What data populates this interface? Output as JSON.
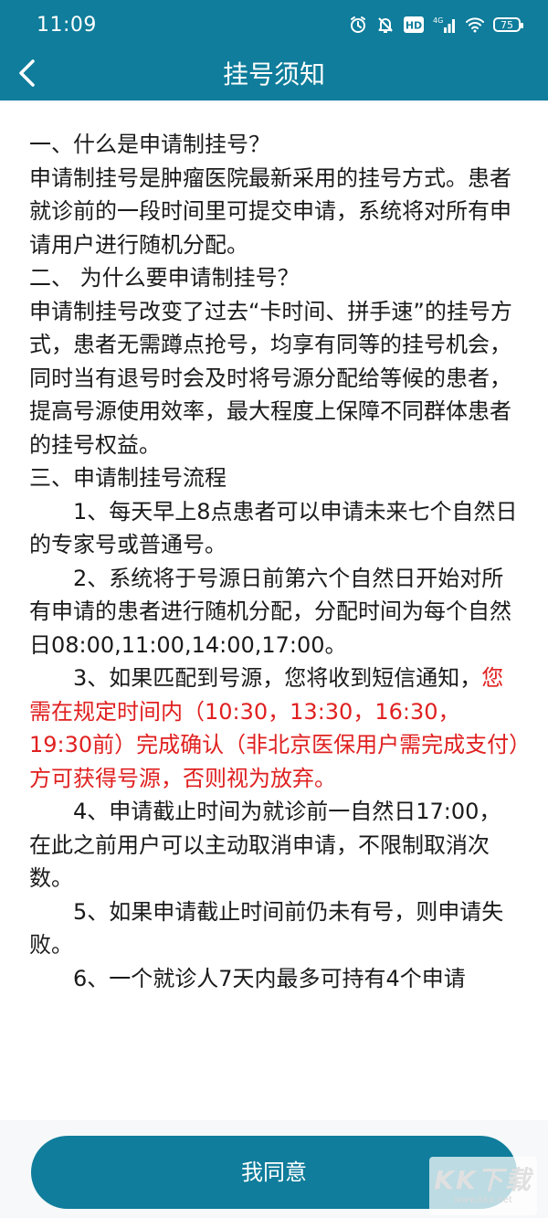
{
  "status_bar": {
    "time": "11:09",
    "icons": [
      "alarm-icon",
      "bell-muted-icon",
      "hd-icon",
      "signal-4g-icon",
      "wifi-icon"
    ],
    "hd_label": "HD",
    "network_label": "4G",
    "battery": "75"
  },
  "nav": {
    "back_icon": "chevron-left-icon",
    "title": "挂号须知"
  },
  "notice": {
    "section1_title": "一、什么是申请制挂号？",
    "section1_p1": "申请制挂号是肿瘤医院最新采用的挂号方式。患者就诊前的一段时间里可提交申请，系统将对所有申请用户进行随机分配。",
    "section2_title": "二、 为什么要申请制挂号？",
    "section2_p1": "申请制挂号改变了过去“卡时间、拼手速”的挂号方式，患者无需蹲点抢号，均享有同等的挂号机会，同时当有退号时会及时将号源分配给等候的患者，提高号源使用效率，最大程度上保障不同群体患者的挂号权益。",
    "section3_title": "三、申请制挂号流程",
    "step1": "1、每天早上8点患者可以申请未来七个自然日的专家号或普通号。",
    "step2": "2、系统将于号源日前第六个自然日开始对所有申请的患者进行随机分配，分配时间为每个自然日08:00,11:00,14:00,17:00。",
    "step3_prefix": "3、如果匹配到号源，您将收到短信通知，",
    "step3_highlight": "您需在规定时间内（10:30，13:30，16:30，19:30前）完成确认（非北京医保用户需完成支付）方可获得号源，否则视为放弃。",
    "step4": "4、申请截止时间为就诊前一自然日17:00，在此之前用户可以主动取消申请，不限制取消次数。",
    "step5": "5、如果申请截止时间前仍未有号，则申请失败。",
    "step6": "6、一个就诊人7天内最多可持有4个申请"
  },
  "colors": {
    "primary": "#0f7d9b",
    "highlight": "#e02020"
  },
  "agree_button": {
    "label": "我同意"
  },
  "watermark": {
    "mark": "KK下载",
    "url": "www.kkx.net"
  }
}
